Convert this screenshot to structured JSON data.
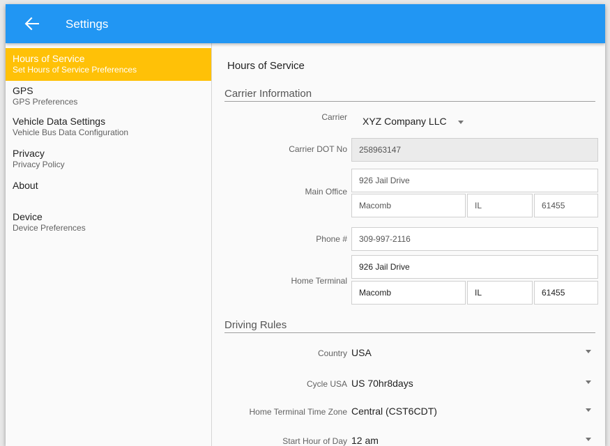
{
  "appbar": {
    "title": "Settings",
    "back_icon": "arrow-left-icon",
    "color": "#2196f3"
  },
  "sidebar": {
    "active_color": "#ffc107",
    "items": [
      {
        "title": "Hours of Service",
        "subtitle": "Set Hours of Service Preferences"
      },
      {
        "title": "GPS",
        "subtitle": "GPS Preferences"
      },
      {
        "title": "Vehicle Data Settings",
        "subtitle": "Vehicle Bus Data Configuration"
      },
      {
        "title": "Privacy",
        "subtitle": "Privacy Policy"
      },
      {
        "title": "About",
        "subtitle": ""
      },
      {
        "title": "Device",
        "subtitle": "Device Preferences"
      }
    ]
  },
  "main": {
    "title": "Hours of Service",
    "carrier_section": {
      "header": "Carrier Information",
      "carrier": {
        "label": "Carrier",
        "value": "XYZ Company LLC"
      },
      "dot": {
        "label": "Carrier DOT No",
        "value": "258963147"
      },
      "main_office": {
        "label": "Main Office",
        "street": "926 Jail Drive",
        "city": "Macomb",
        "state": "IL",
        "zip": "61455"
      },
      "phone": {
        "label": "Phone #",
        "value": "309-997-2116"
      },
      "home_terminal": {
        "label": "Home Terminal",
        "street": "926 Jail Drive",
        "city": "Macomb",
        "state": "IL",
        "zip": "61455"
      }
    },
    "driving_section": {
      "header": "Driving Rules",
      "country": {
        "label": "Country",
        "value": "USA"
      },
      "cycle": {
        "label": "Cycle USA",
        "value": "US 70hr8days"
      },
      "timezone": {
        "label": "Home Terminal Time Zone",
        "value": "Central (CST6CDT)"
      },
      "start_hour": {
        "label": "Start Hour of Day",
        "value": "12 am"
      }
    }
  }
}
